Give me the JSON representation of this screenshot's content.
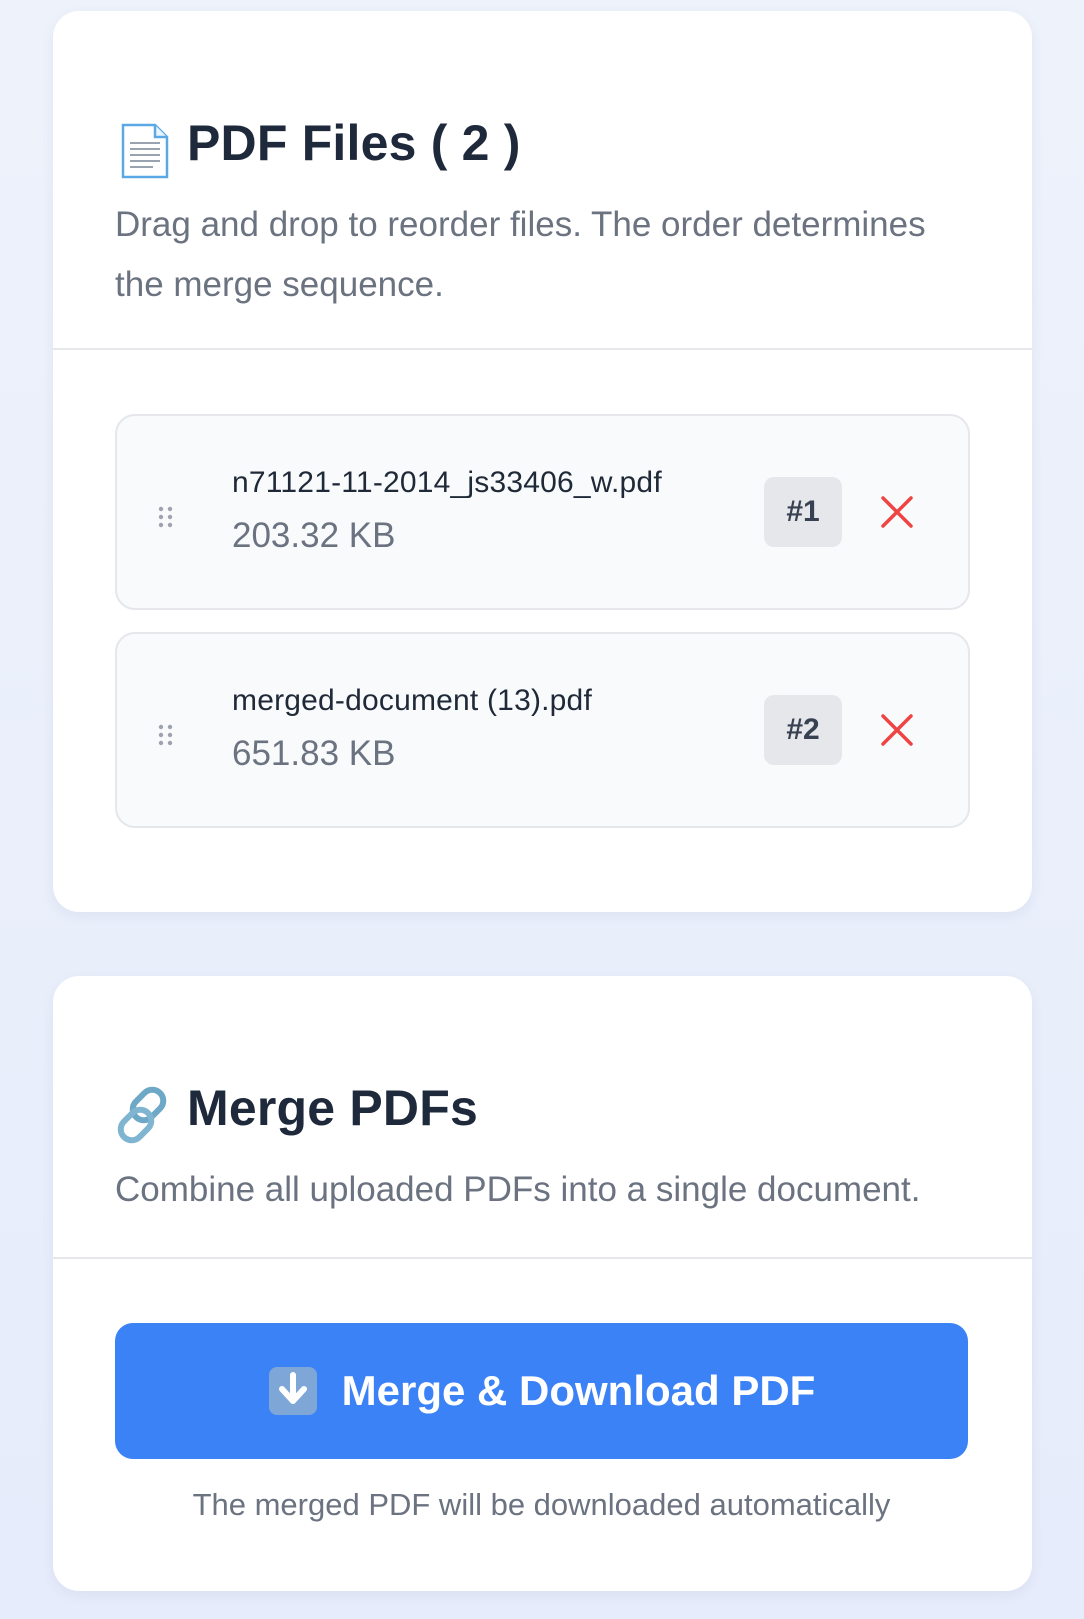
{
  "files_panel": {
    "title_prefix": "PDF Files",
    "title_count": "( 2 )",
    "subtitle": "Drag and drop to reorder files. The order determines the merge sequence.",
    "icon": "page-document-icon",
    "files": [
      {
        "name": "n71121-11-2014_js33406_w.pdf",
        "size": "203.32 KB",
        "order": "#1"
      },
      {
        "name": "merged-document (13).pdf",
        "size": "651.83 KB",
        "order": "#2"
      }
    ]
  },
  "merge_panel": {
    "title": "Merge PDFs",
    "icon": "link-icon",
    "subtitle": "Combine all uploaded PDFs into a single document.",
    "button_label": "Merge & Download PDF",
    "button_icon": "download-arrow-icon",
    "hint": "The merged PDF will be downloaded automatically"
  },
  "colors": {
    "accent": "#3b82f6",
    "remove": "#ef4444",
    "badge_bg": "#e5e7eb"
  }
}
